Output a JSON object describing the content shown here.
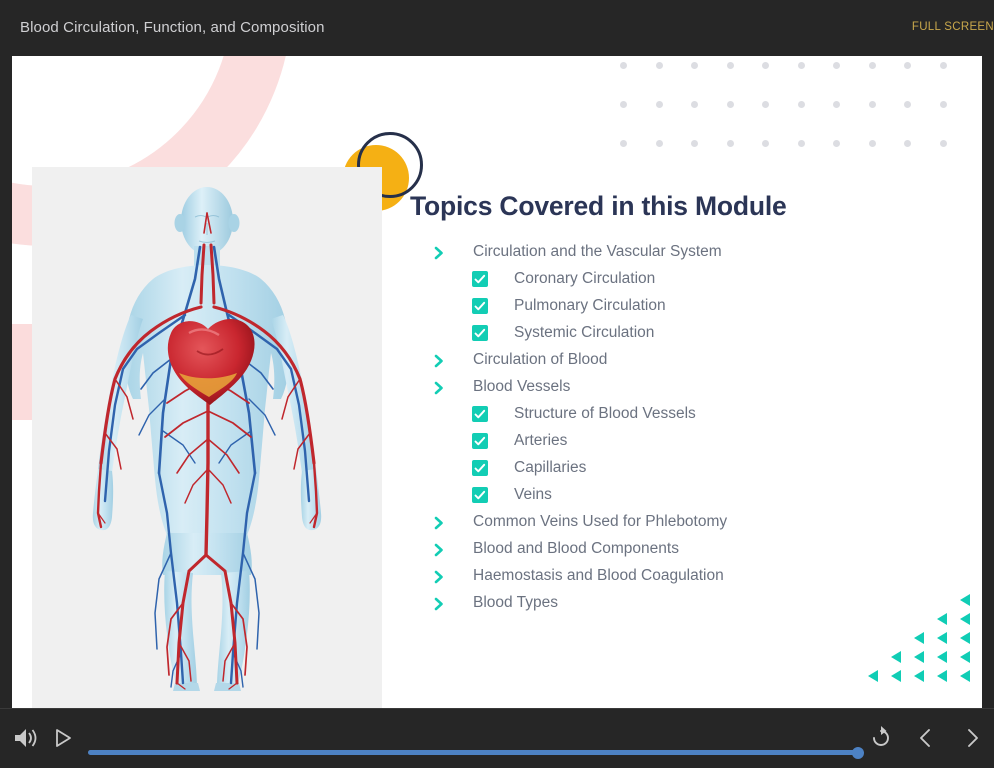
{
  "header": {
    "title": "Blood Circulation, Function, and Composition",
    "fullscreen_label": "FULL SCREEN"
  },
  "slide": {
    "heading": "Topics Covered in this Module",
    "image_alt": "human-circulatory-system-diagram",
    "topics": [
      {
        "label": "Circulation and the Vascular System",
        "level": 1,
        "marker": "chevron"
      },
      {
        "label": "Coronary Circulation",
        "level": 2,
        "marker": "checkbox"
      },
      {
        "label": "Pulmonary Circulation",
        "level": 2,
        "marker": "checkbox"
      },
      {
        "label": "Systemic Circulation",
        "level": 2,
        "marker": "checkbox"
      },
      {
        "label": "Circulation of Blood",
        "level": 1,
        "marker": "chevron"
      },
      {
        "label": "Blood Vessels",
        "level": 1,
        "marker": "chevron"
      },
      {
        "label": "Structure of Blood Vessels",
        "level": 2,
        "marker": "checkbox"
      },
      {
        "label": "Arteries",
        "level": 2,
        "marker": "checkbox"
      },
      {
        "label": "Capillaries",
        "level": 2,
        "marker": "checkbox"
      },
      {
        "label": "Veins",
        "level": 2,
        "marker": "checkbox"
      },
      {
        "label": "Common Veins Used for Phlebotomy",
        "level": 1,
        "marker": "chevron"
      },
      {
        "label": "Blood and Blood Components",
        "level": 1,
        "marker": "chevron"
      },
      {
        "label": "Haemostasis and Blood Coagulation",
        "level": 1,
        "marker": "chevron"
      },
      {
        "label": "Blood Types",
        "level": 1,
        "marker": "chevron"
      }
    ],
    "decor": {
      "dot_grid_cols": 10,
      "dot_grid_rows": 3,
      "triangle_rows": [
        1,
        2,
        3,
        4,
        5
      ]
    }
  },
  "controls": {
    "volume_icon": "speaker-volume-icon",
    "play_icon": "play-icon",
    "replay_icon": "replay-icon",
    "prev_icon": "chevron-left-icon",
    "next_icon": "chevron-right-icon",
    "progress_percent": 100
  },
  "colors": {
    "chrome": "#262626",
    "accent_teal": "#12cdb4",
    "accent_orange": "#f5b014",
    "accent_pink": "#fbdede",
    "heading_navy": "#2b3556",
    "seek_blue": "#4d82c4",
    "fullscreen_gold": "#c9a84c",
    "panel_gray": "#f0f0f0"
  }
}
